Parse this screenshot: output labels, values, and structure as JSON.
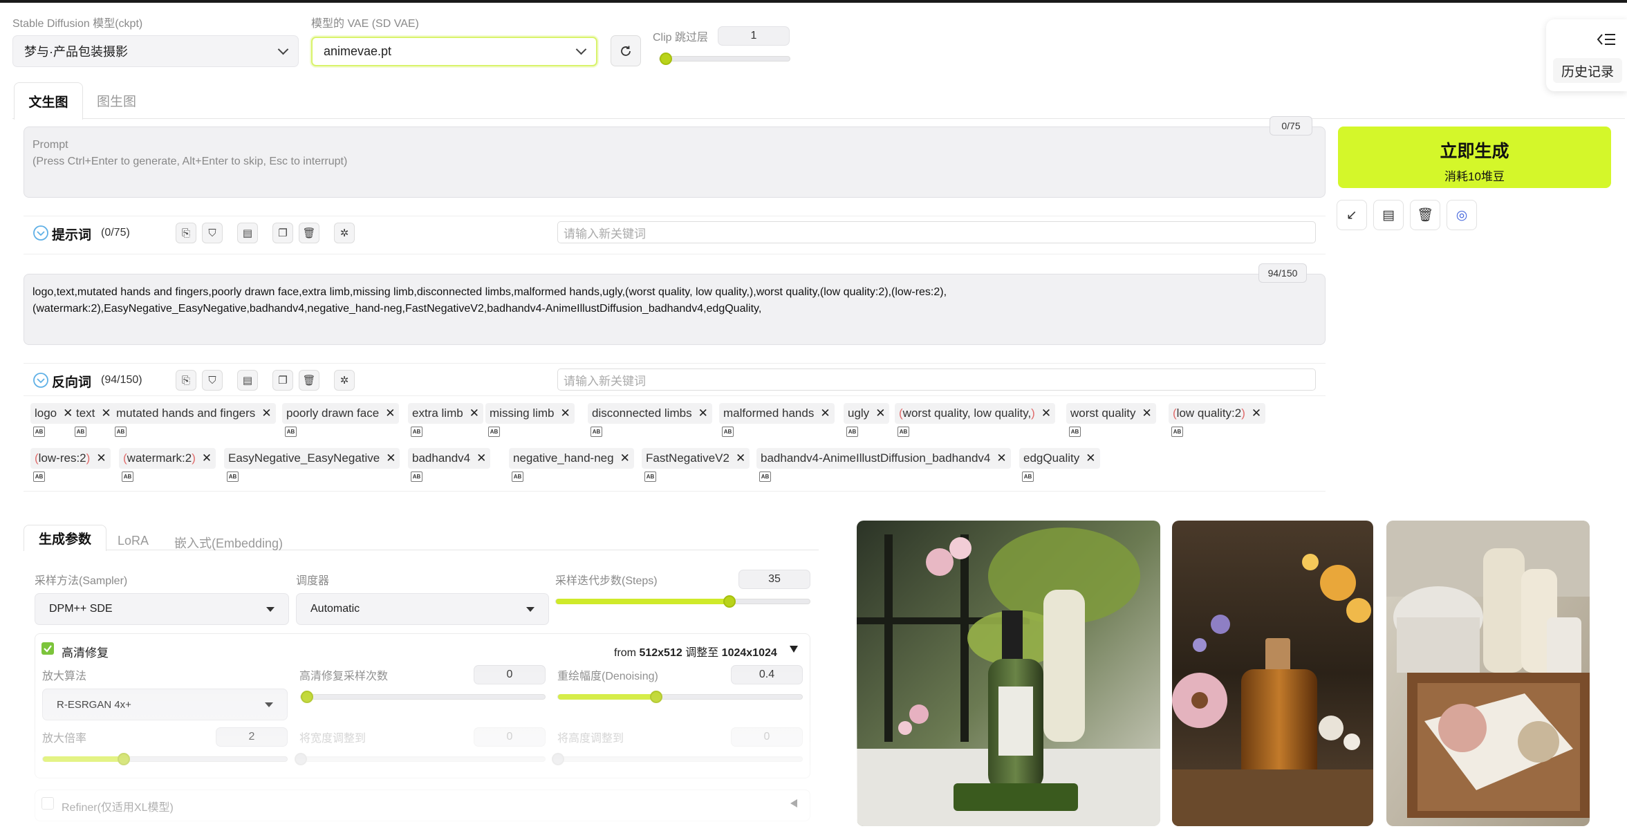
{
  "top": {
    "model_label": "Stable Diffusion 模型(ckpt)",
    "model_value": "梦与·产品包装摄影",
    "vae_label": "模型的 VAE (SD VAE)",
    "vae_value": "animevae.pt",
    "clip_label": "Clip 跳过层",
    "clip_value": "1",
    "clip_fraction": 0.0
  },
  "history": {
    "label": "历史记录"
  },
  "main_tabs": [
    "文生图",
    "图生图"
  ],
  "prompt": {
    "placeholder_title": "Prompt",
    "placeholder_hint": "(Press Ctrl+Enter to generate, Alt+Enter to skip, Esc to interrupt)",
    "counter": "0/75",
    "section_label": "提示词",
    "section_count": "(0/75)",
    "keyword_placeholder": "请输入新关键词"
  },
  "generate": {
    "title": "立即生成",
    "subtitle": "消耗10堆豆"
  },
  "negative": {
    "counter": "94/150",
    "text_line1": "logo,text,mutated hands and fingers,poorly drawn face,extra limb,missing limb,disconnected limbs,malformed hands,ugly,(worst quality, low quality,),worst quality,(low quality:2),(low-res:2),",
    "text_line2": "(watermark:2),EasyNegative_EasyNegative,badhandv4,negative_hand-neg,FastNegativeV2,badhandv4-AnimeIllustDiffusion_badhandv4,edgQuality,",
    "section_label": "反向词",
    "section_count": "(94/150)",
    "keyword_placeholder": "请输入新关键词",
    "chips_row1": [
      {
        "pre": "",
        "text": "logo",
        "post": ""
      },
      {
        "pre": "",
        "text": "text",
        "post": ""
      },
      {
        "pre": "",
        "text": "mutated hands and fingers",
        "post": ""
      },
      {
        "pre": "",
        "text": "poorly drawn face",
        "post": ""
      },
      {
        "pre": "",
        "text": "extra limb",
        "post": ""
      },
      {
        "pre": "",
        "text": "missing limb",
        "post": ""
      },
      {
        "pre": "",
        "text": "disconnected limbs",
        "post": ""
      },
      {
        "pre": "",
        "text": "malformed hands",
        "post": ""
      },
      {
        "pre": "",
        "text": "ugly",
        "post": ""
      },
      {
        "pre": "(",
        "text": "worst quality, low quality,",
        "post": ")"
      },
      {
        "pre": "",
        "text": "worst quality",
        "post": ""
      },
      {
        "pre": "(",
        "text": "low quality:2",
        "post": ")"
      }
    ],
    "chips_row2": [
      {
        "pre": "(",
        "text": "low-res:2",
        "post": ")"
      },
      {
        "pre": "(",
        "text": "watermark:2",
        "post": ")"
      },
      {
        "pre": "",
        "text": "EasyNegative_EasyNegative",
        "post": ""
      },
      {
        "pre": "",
        "text": "badhandv4",
        "post": ""
      },
      {
        "pre": "",
        "text": "negative_hand-neg",
        "post": ""
      },
      {
        "pre": "",
        "text": "FastNegativeV2",
        "post": ""
      },
      {
        "pre": "",
        "text": "badhandv4-AnimeIllustDiffusion_badhandv4",
        "post": ""
      },
      {
        "pre": "",
        "text": "edgQuality",
        "post": ""
      }
    ],
    "chip_sub_label": "AB"
  },
  "params": {
    "tabs": [
      "生成参数",
      "LoRA",
      "嵌入式(Embedding)"
    ],
    "sampler_label": "采样方法(Sampler)",
    "sampler_value": "DPM++ SDE",
    "scheduler_label": "调度器",
    "scheduler_value": "Automatic",
    "steps_label": "采样迭代步数(Steps)",
    "steps_value": "35",
    "steps_fraction": 0.68,
    "hires_label": "高清修复",
    "hires_from": "from",
    "hires_src": "512x512",
    "hires_to": "调整至",
    "hires_dst": "1024x1024",
    "upscaler_label": "放大算法",
    "upscaler_value": "R-ESRGAN 4x+",
    "hires_steps_label": "高清修复采样次数",
    "hires_steps_value": "0",
    "hires_steps_fraction": 0.0,
    "denoise_label": "重绘幅度(Denoising)",
    "denoise_value": "0.4",
    "denoise_fraction": 0.4,
    "scale_label": "放大倍率",
    "scale_value": "2",
    "scale_fraction": 0.33,
    "width_label": "将宽度调整到",
    "width_value": "0",
    "height_label": "将高度调整到",
    "height_value": "0",
    "refiner_label": "Refiner(仅适用XL模型)"
  },
  "colors": {
    "accent": "#d4f72a",
    "accent_dark": "#b9d31a",
    "check": "#7cc43b"
  }
}
